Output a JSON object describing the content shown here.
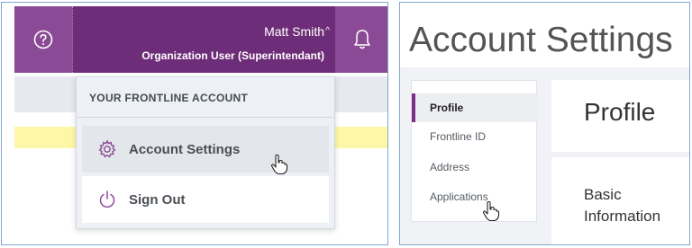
{
  "header": {
    "user_name": "Matt Smith",
    "caret": "^",
    "user_role": "Organization User (Superintendant)"
  },
  "dropdown": {
    "header": "YOUR FRONTLINE ACCOUNT",
    "items": [
      {
        "label": "Account Settings",
        "icon": "gear-icon"
      },
      {
        "label": "Sign Out",
        "icon": "power-icon"
      }
    ]
  },
  "account_settings": {
    "title": "Account Settings",
    "nav": [
      {
        "label": "Profile",
        "active": true
      },
      {
        "label": "Frontline ID",
        "active": false
      },
      {
        "label": "Address",
        "active": false
      },
      {
        "label": "Applications",
        "active": false
      }
    ],
    "section_heading": "Profile",
    "subsection": "Basic Information"
  },
  "colors": {
    "topbar": "#6e2d78",
    "topbar_button": "#8b4a96",
    "accent": "#7b2f86",
    "highlight_strip": "#fdf8a8"
  }
}
